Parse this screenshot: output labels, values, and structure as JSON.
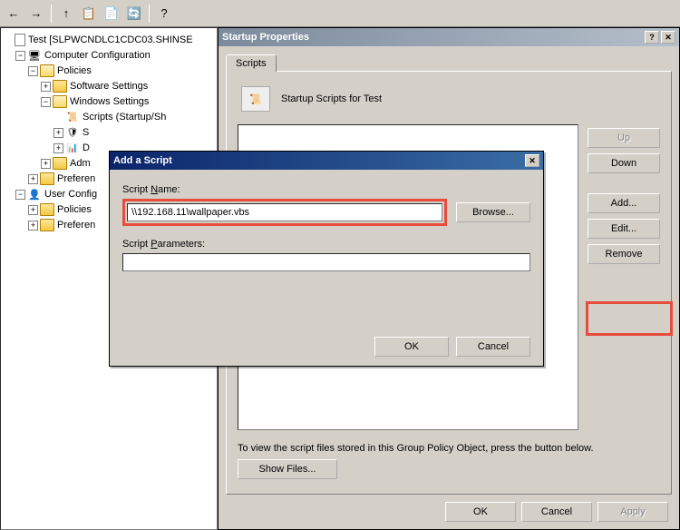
{
  "toolbar": {
    "back": "←",
    "forward": "→",
    "up": "↑",
    "copy": "📋",
    "props": "📄",
    "refresh": "🔄",
    "help": "?"
  },
  "tree": {
    "root": "Test [SLPWCNDLC1CDC03.SHINSE",
    "comp_config": "Computer Configuration",
    "policies": "Policies",
    "software_settings": "Software Settings",
    "windows_settings": "Windows Settings",
    "scripts": "Scripts (Startup/Sh",
    "node_security": "S",
    "node_deployed": "D",
    "node_admin": "Adm",
    "preferences": "Preferen",
    "user_config": "User Config",
    "user_policies": "Policies",
    "user_preferences": "Preferen"
  },
  "startup": {
    "title": "Startup Properties",
    "tab_scripts": "Scripts",
    "header_text": "Startup Scripts for Test",
    "btn_up": "Up",
    "btn_down": "Down",
    "btn_add": "Add...",
    "btn_edit": "Edit...",
    "btn_remove": "Remove",
    "hint": "To view the script files stored in this Group Policy Object, press the button below.",
    "btn_showfiles": "Show Files...",
    "btn_ok": "OK",
    "btn_cancel": "Cancel",
    "btn_apply": "Apply",
    "help_glyph": "?",
    "close_glyph": "✕"
  },
  "addscript": {
    "title": "Add a Script",
    "script_name_label_pre": "Script ",
    "script_name_label_ul": "N",
    "script_name_label_post": "ame:",
    "script_name_value": "\\\\192.168.11\\wallpaper.vbs",
    "btn_browse": "Browse...",
    "params_label_pre": "Script ",
    "params_label_ul": "P",
    "params_label_post": "arameters:",
    "params_value": "",
    "btn_ok": "OK",
    "btn_cancel": "Cancel",
    "close_glyph": "✕"
  }
}
